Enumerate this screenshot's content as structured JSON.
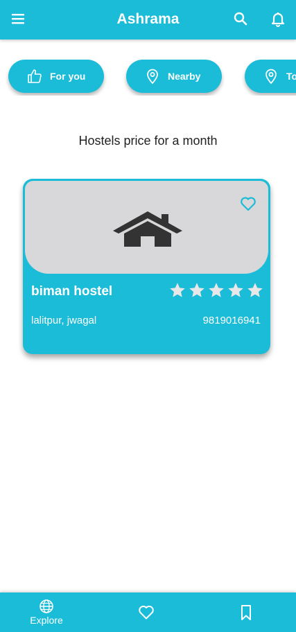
{
  "app": {
    "title": "Ashrama"
  },
  "colors": {
    "primary": "#1bbcd8",
    "card_image_bg": "#d8d8da",
    "text_dark": "#222222",
    "icon_dark": "#333333",
    "favorite_outline": "#1bbcd8"
  },
  "header": {
    "menu_icon": "hamburger-icon",
    "search_icon": "search-icon",
    "notification_icon": "bell-icon"
  },
  "chips": [
    {
      "label": "For you",
      "icon": "thumbs-up-icon"
    },
    {
      "label": "Nearby",
      "icon": "location-pin-icon"
    },
    {
      "label": "Top",
      "icon": "location-pin-icon"
    }
  ],
  "section": {
    "title": "Hostels price for a month"
  },
  "hostels": [
    {
      "name": "biman hostel",
      "location": "lalitpur, jwagal",
      "phone": "9819016941",
      "rating": 5,
      "rating_max": 5,
      "image_icon": "house-icon",
      "favorite_icon": "heart-outline-icon"
    }
  ],
  "bottom_nav": [
    {
      "label": "Explore",
      "icon": "globe-icon",
      "active": true
    },
    {
      "label": "",
      "icon": "heart-outline-icon"
    },
    {
      "label": "",
      "icon": "bookmark-icon"
    }
  ]
}
